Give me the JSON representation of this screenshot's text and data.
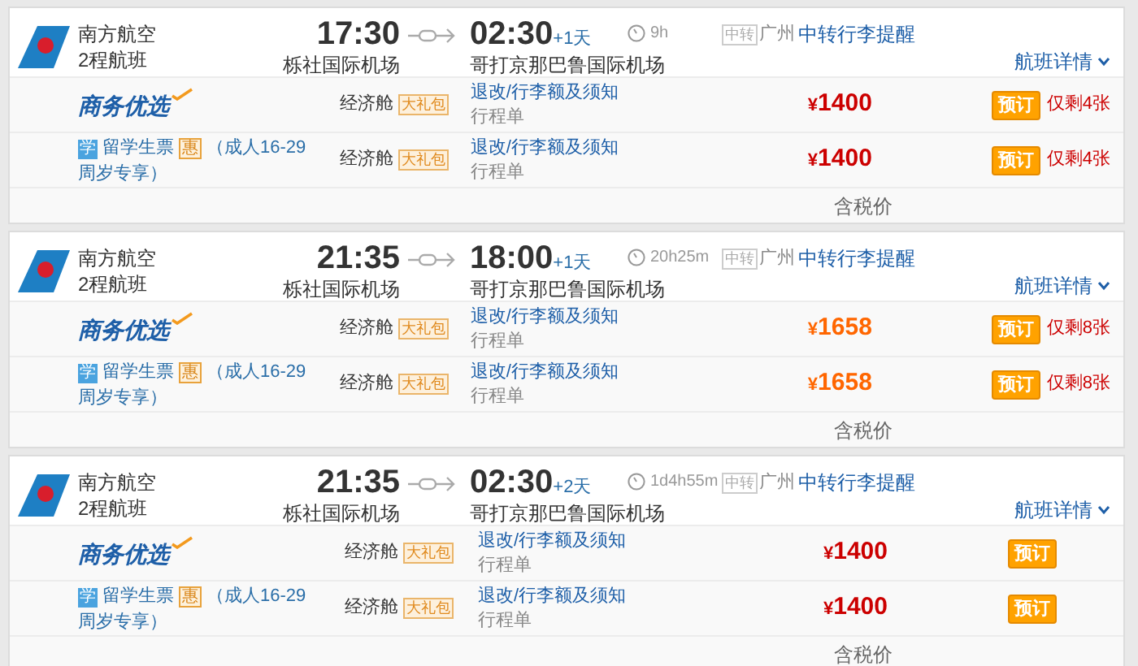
{
  "flights": [
    {
      "airline": "南方航空",
      "flight_type": "2程航班",
      "depart_time": "17:30",
      "depart_airport": "栎社国际机场",
      "arrive_time": "02:30",
      "day_offset": "+1天",
      "arrive_airport": "哥打京那巴鲁国际机场",
      "duration": "9h",
      "transit_badge": "中转",
      "transit_city": "广州",
      "baggage_link": "中转行李提醒",
      "details_link": "航班详情",
      "fares": [
        {
          "kind": "brand",
          "product": "商务优选",
          "cabin": "经济舱",
          "gift": "大礼包",
          "notes_link": "退改/行李额及须知",
          "itinerary": "行程单",
          "currency": "¥",
          "price": "1400",
          "color": "#cc0000",
          "book": "预订",
          "remaining": "仅剩4张"
        },
        {
          "kind": "student",
          "badge": "学",
          "product": "留学生票",
          "discount": "惠",
          "condition": "（成人16-29周岁专享）",
          "cabin": "经济舱",
          "gift": "大礼包",
          "notes_link": "退改/行李额及须知",
          "itinerary": "行程单",
          "currency": "¥",
          "price": "1400",
          "color": "#cc0000",
          "book": "预订",
          "remaining": "仅剩4张"
        }
      ],
      "tax_note": "含税价"
    },
    {
      "airline": "南方航空",
      "flight_type": "2程航班",
      "depart_time": "21:35",
      "depart_airport": "栎社国际机场",
      "arrive_time": "18:00",
      "day_offset": "+1天",
      "arrive_airport": "哥打京那巴鲁国际机场",
      "duration": "20h25m",
      "transit_badge": "中转",
      "transit_city": "广州",
      "baggage_link": "中转行李提醒",
      "details_link": "航班详情",
      "fares": [
        {
          "kind": "brand",
          "product": "商务优选",
          "cabin": "经济舱",
          "gift": "大礼包",
          "notes_link": "退改/行李额及须知",
          "itinerary": "行程单",
          "currency": "¥",
          "price": "1658",
          "color": "#ff6600",
          "book": "预订",
          "remaining": "仅剩8张"
        },
        {
          "kind": "student",
          "badge": "学",
          "product": "留学生票",
          "discount": "惠",
          "condition": "（成人16-29周岁专享）",
          "cabin": "经济舱",
          "gift": "大礼包",
          "notes_link": "退改/行李额及须知",
          "itinerary": "行程单",
          "currency": "¥",
          "price": "1658",
          "color": "#ff6600",
          "book": "预订",
          "remaining": "仅剩8张"
        }
      ],
      "tax_note": "含税价"
    },
    {
      "airline": "南方航空",
      "flight_type": "2程航班",
      "depart_time": "21:35",
      "depart_airport": "栎社国际机场",
      "arrive_time": "02:30",
      "day_offset": "+2天",
      "arrive_airport": "哥打京那巴鲁国际机场",
      "duration": "1d4h55m",
      "transit_badge": "中转",
      "transit_city": "广州",
      "baggage_link": "中转行李提醒",
      "details_link": "航班详情",
      "fares": [
        {
          "kind": "brand",
          "product": "商务优选",
          "cabin": "经济舱",
          "gift": "大礼包",
          "notes_link": "退改/行李额及须知",
          "itinerary": "行程单",
          "currency": "¥",
          "price": "1400",
          "color": "#cc0000",
          "book": "预订"
        },
        {
          "kind": "student",
          "badge": "学",
          "product": "留学生票",
          "discount": "惠",
          "condition": "（成人16-29周岁专享）",
          "cabin": "经济舱",
          "gift": "大礼包",
          "notes_link": "退改/行李额及须知",
          "itinerary": "行程单",
          "currency": "¥",
          "price": "1400",
          "color": "#cc0000",
          "book": "预订"
        }
      ],
      "tax_note": "含税价"
    }
  ]
}
